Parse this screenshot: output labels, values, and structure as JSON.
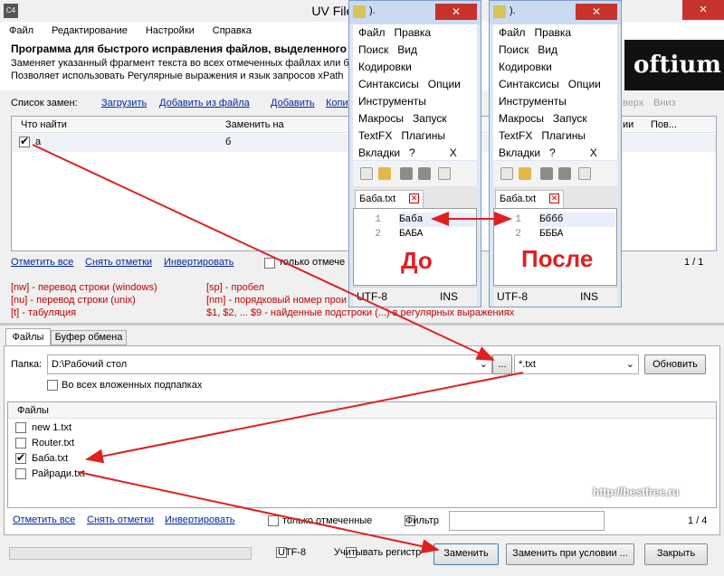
{
  "main": {
    "title": "UV FilesCorrector",
    "menu": [
      "Файл",
      "Редактирование",
      "Настройки",
      "Справка"
    ],
    "desc_line1": "Программа для быстрого исправления файлов, выделенного т",
    "desc_line2": "Заменяет указанный фрагмент текста во всех отмеченных файлах или б",
    "desc_line3": "Позволяет использовать Регулярные выражения и язык запросов xPath",
    "logo_text": "oftium"
  },
  "replacements": {
    "label": "Список замен:",
    "actions": [
      "Загрузить",
      "Добавить из файла",
      "Добавить",
      "Копи"
    ],
    "right_actions": [
      "верх",
      "Вниз"
    ],
    "columns": [
      "Что найти",
      "Заменить на",
      "ии",
      "Пов..."
    ],
    "rows": [
      {
        "find": "а",
        "replace": "б",
        "checked": true
      }
    ],
    "bottom_links": [
      "Отметить все",
      "Снять отметки",
      "Инвертировать"
    ],
    "only_checked": "только отмече",
    "counter": "1 / 1"
  },
  "help": {
    "left": [
      "[nw] - перевод строки (windows)",
      "[nu] - перевод строки (unix)",
      "[t] - табуляция"
    ],
    "right": [
      "[sp] - пробел",
      "[nm] - порядковый номер прои",
      "$1, $2, ... $9 - найденные подстроки (...) в регулярных выражениях"
    ]
  },
  "tabs": [
    "Файлы",
    "Буфер обмена"
  ],
  "folder": {
    "label": "Папка:",
    "path": "D:\\Рабочий стол",
    "browse": "...",
    "mask": "*.txt",
    "refresh": "Обновить",
    "subfolders": "Во всех вложенных подпапках"
  },
  "files": {
    "header": "Файлы",
    "items": [
      {
        "name": "new 1.txt",
        "checked": false
      },
      {
        "name": "Router.txt",
        "checked": false
      },
      {
        "name": "Баба.txt",
        "checked": true
      },
      {
        "name": "Райради.txt",
        "checked": false
      }
    ],
    "bottom_links": [
      "Отметить все",
      "Снять отметки",
      "Инвертировать"
    ],
    "only_checked": "только отмеченные",
    "filter_label": "Фильтр",
    "counter": "1 / 4",
    "watermark": "http://bestfree.ru"
  },
  "footer": {
    "utf8": "UTF-8",
    "case": "Учитывать регистр",
    "replace": "Заменить",
    "replace_cond": "Заменить при условии ...",
    "close": "Закрыть"
  },
  "notepad_before": {
    "title": ").",
    "close": "✕",
    "menu_rows": [
      [
        "Файл",
        "Правка"
      ],
      [
        "Поиск",
        "Вид"
      ],
      [
        "Кодировки"
      ],
      [
        "Синтаксисы",
        "Опции"
      ],
      [
        "Инструменты"
      ],
      [
        "Макросы",
        "Запуск"
      ],
      [
        "TextFX",
        "Плагины"
      ],
      [
        "Вкладки",
        "?",
        "X"
      ]
    ],
    "tab": "Баба.txt",
    "lines": [
      "1",
      "2"
    ],
    "code": [
      "Баба",
      "БАБА"
    ],
    "label": "До",
    "encoding": "UTF-8",
    "mode": "INS"
  },
  "notepad_after": {
    "title": ").",
    "close": "✕",
    "menu_rows": [
      [
        "Файл",
        "Правка"
      ],
      [
        "Поиск",
        "Вид"
      ],
      [
        "Кодировки"
      ],
      [
        "Синтаксисы",
        "Опции"
      ],
      [
        "Инструменты"
      ],
      [
        "Макросы",
        "Запуск"
      ],
      [
        "TextFX",
        "Плагины"
      ],
      [
        "Вкладки",
        "?",
        "X"
      ]
    ],
    "tab": "Баба.txt",
    "lines": [
      "1",
      "2"
    ],
    "code": [
      "Бббб",
      "БББА"
    ],
    "label": "После",
    "encoding": "UTF-8",
    "mode": "INS"
  },
  "colors": {
    "accent_red": "#e02020",
    "link": "#0026a3",
    "close_red": "#c7332c"
  }
}
